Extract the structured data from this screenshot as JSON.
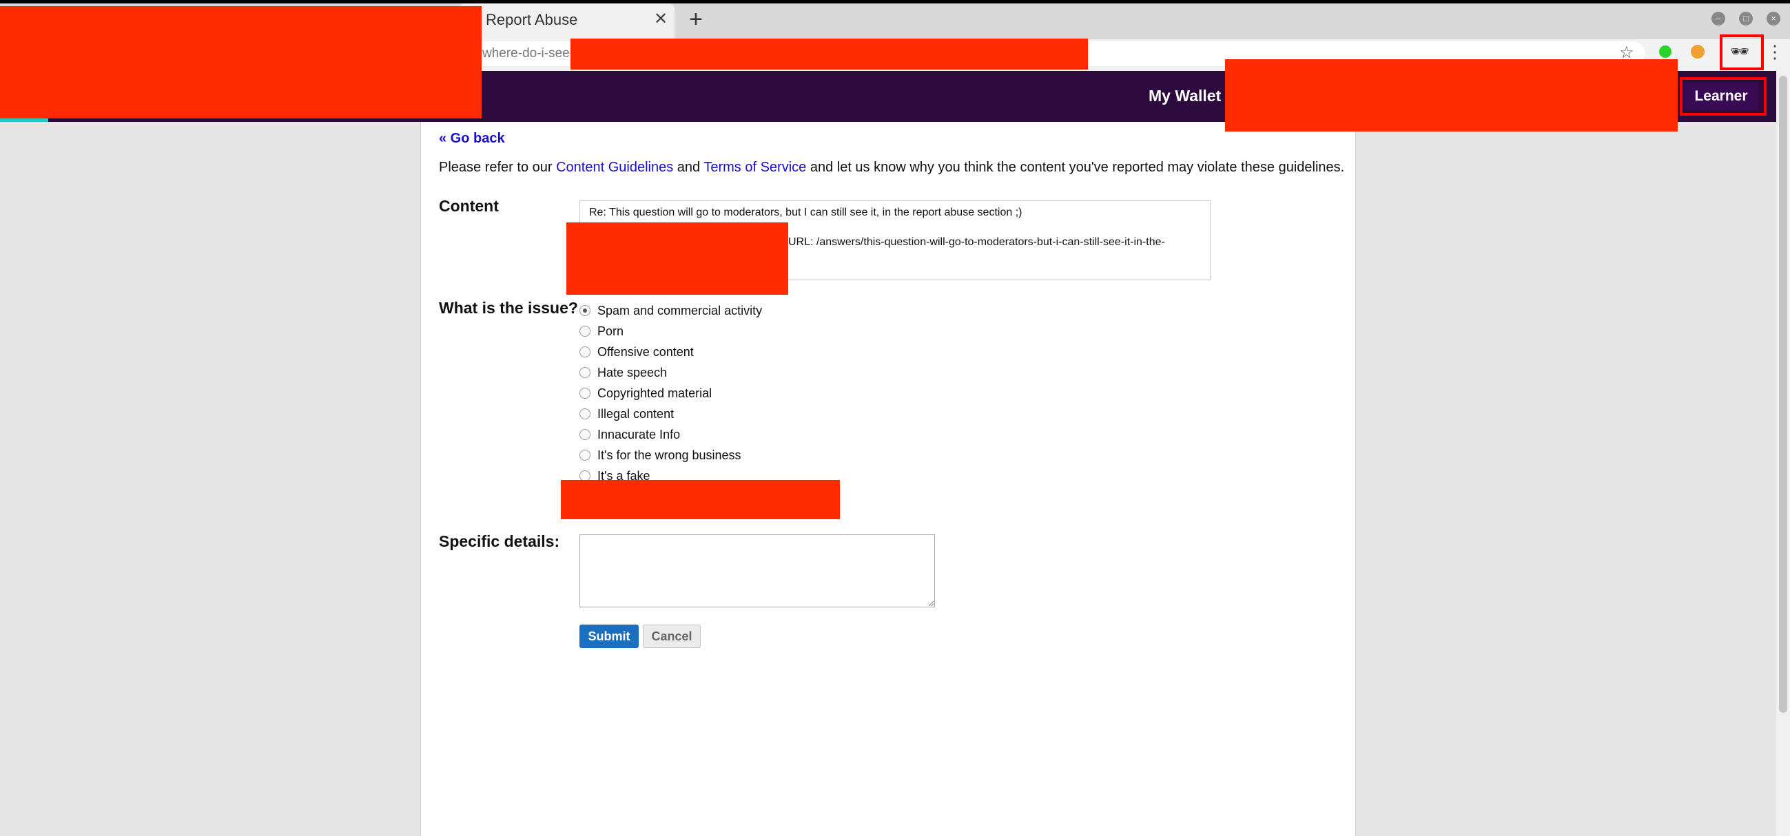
{
  "browser": {
    "tab_title": "Report Abuse",
    "tab_close": "✕",
    "new_tab": "+",
    "url_visible": "where-do-i-see-",
    "icons": [
      "star-icon",
      "extension-green-icon",
      "extension-cookie-icon",
      "incognito-icon",
      "menu-icon"
    ]
  },
  "nav": {
    "wallet": "My Wallet",
    "role_button": "Learner"
  },
  "page": {
    "go_back": "« Go back",
    "intro_prefix": "Please refer to our ",
    "content_guidelines_link": "Content Guidelines",
    "intro_and": " and ",
    "terms_link": "Terms of Service",
    "intro_suffix": " and let us know why you think the content you've reported may violate these guidelines.",
    "content_label": "Content",
    "content_title": "Re: This question will go to moderators, but I can still see it, in the report abuse section ;)",
    "content_url": "URL: /answers/this-question-will-go-to-moderators-but-i-can-still-see-it-in-the-",
    "issue_label": "What is the issue?",
    "issues": [
      {
        "label": "Spam and commercial activity",
        "checked": true
      },
      {
        "label": "Porn",
        "checked": false
      },
      {
        "label": "Offensive content",
        "checked": false
      },
      {
        "label": "Hate speech",
        "checked": false
      },
      {
        "label": "Copyrighted material",
        "checked": false
      },
      {
        "label": "Illegal content",
        "checked": false
      },
      {
        "label": "Innacurate Info",
        "checked": false
      },
      {
        "label": "It's for the wrong business",
        "checked": false
      },
      {
        "label": "It's a fake",
        "checked": false
      }
    ],
    "details_label": "Specific details:",
    "details_value": "",
    "submit": "Submit",
    "cancel": "Cancel"
  },
  "colors": {
    "nav_bg": "#2d0a3d",
    "link": "#1a0dcc",
    "submit_bg": "#1a6fc0",
    "redaction": "#ff2a00"
  }
}
